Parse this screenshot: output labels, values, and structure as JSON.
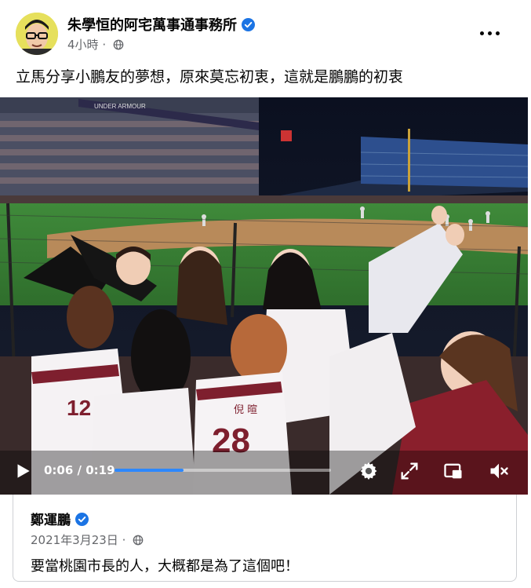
{
  "post": {
    "author": "朱學恒的阿宅萬事通事務所",
    "time_ago": "4小時",
    "meta_sep": " · ",
    "privacy_icon": "globe-icon",
    "text": "立馬分享小鵬友的夢想，原來莫忘初衷，這就是鵬鵬的初衷"
  },
  "video": {
    "current_time": "0:06",
    "duration": "0:19",
    "time_separator": " / ",
    "progress": 0.32,
    "jersey_number": "28",
    "jersey_name": "倪 暄",
    "jersey_number_left": "12",
    "banner_text": "UNDER ARMOUR"
  },
  "shared_post": {
    "author": "鄭運鵬",
    "date": "2021年3月23日",
    "meta_sep": " · ",
    "text": "要當桃園市長的人，大概都是為了這個吧！"
  },
  "colors": {
    "verified_blue": "#1b74e4",
    "progress_blue": "#2d88ff",
    "text_primary": "#050505",
    "text_secondary": "#65676b"
  }
}
